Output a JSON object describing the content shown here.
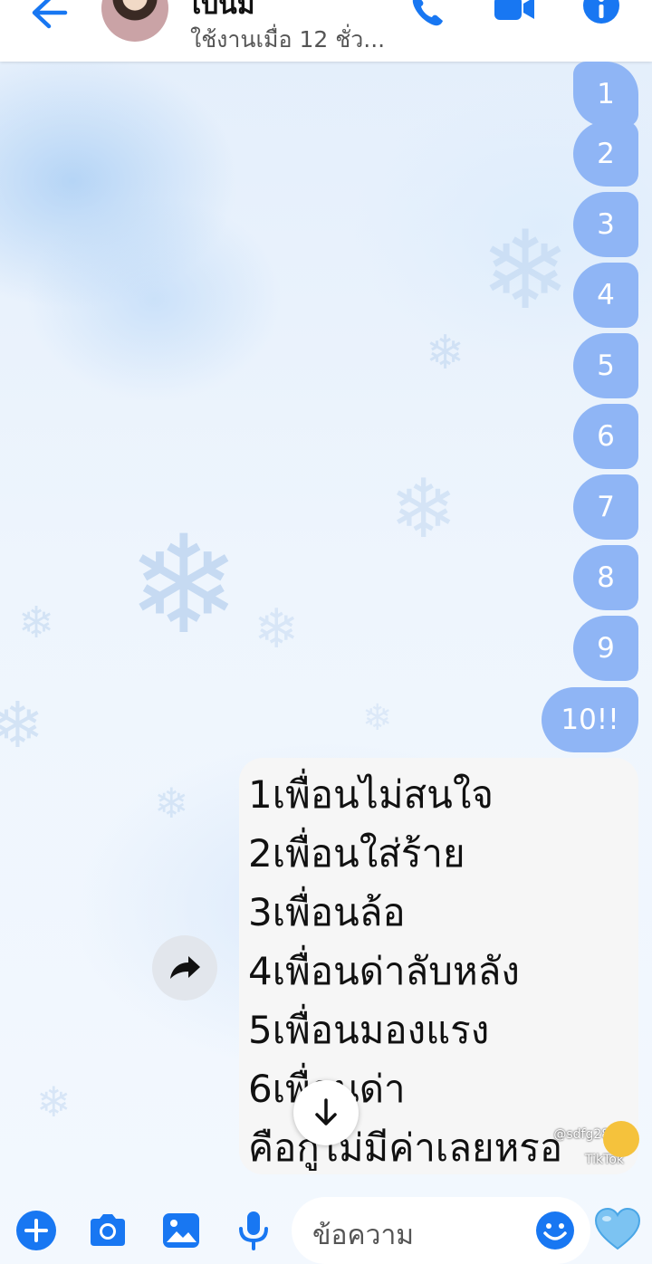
{
  "header": {
    "contact_name": "เบนิม",
    "status": "ใช้งานเมื่อ 12 ชั่ว...",
    "icons": [
      "back-arrow-icon",
      "phone-icon",
      "video-call-icon",
      "info-icon"
    ]
  },
  "messages": {
    "numbers": [
      "1",
      "2",
      "3",
      "4",
      "5",
      "6",
      "7",
      "8",
      "9"
    ],
    "last": "10!!"
  },
  "shared_video": {
    "lines": [
      "1เพื่อนไม่สนใจ",
      "2เพื่อนใส่ร้าย",
      "3เพื่อนล้อ",
      "4เพื่อนด่าลับหลัง",
      "5เพื่อนมองแรง",
      "6เพื่อนด่า",
      "คือกูไม่มีค่าเลยหรอ"
    ],
    "watermark": "TikTok",
    "watermark_id": "@sdfg2895"
  },
  "composer": {
    "placeholder": "ข้อความ",
    "icons": [
      "plus-icon",
      "camera-icon",
      "gallery-icon",
      "microphone-icon",
      "emoji-icon",
      "heart-icon"
    ]
  },
  "colors": {
    "accent": "#1877f2",
    "bubble": "#8fb5f5",
    "heart": "#7cc3f2"
  }
}
